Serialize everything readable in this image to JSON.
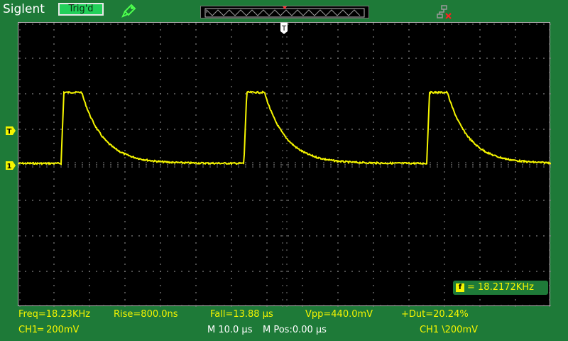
{
  "header": {
    "brand": "Siglent",
    "trigger_status": "Trig'd",
    "icons": [
      "probe-icon",
      "network-disconnected-icon"
    ]
  },
  "colors": {
    "background": "#1e7a38",
    "screen": "#000000",
    "trace": "#f5f500",
    "grid": "#7a7a7a"
  },
  "markers": {
    "trigger_position": "T",
    "trigger_level": "T",
    "channel1": "1"
  },
  "frequency_readout": {
    "icon": "f",
    "text": "= 18.2172KHz"
  },
  "measurements": {
    "freq": "Freq=18.23KHz",
    "rise": "Rise=800.0ns",
    "fall": "Fall=13.88 µs",
    "vpp": "Vpp=440.0mV",
    "duty": "+Dut=20.24%"
  },
  "status_bar": {
    "ch1_scale": "CH1═ 200mV",
    "time_base": "M 10.0 µs",
    "position": "M Pos:0.00 µs",
    "trigger": "CH1 \\200mV"
  },
  "waveform": {
    "baseline_div": 0.0,
    "peak_div": 2.0,
    "edge_times_div": [
      1.2,
      6.35,
      11.5
    ],
    "high_hold_div": 0.5,
    "decay_tau_div": 0.6,
    "grid_divs": [
      15,
      8
    ]
  }
}
